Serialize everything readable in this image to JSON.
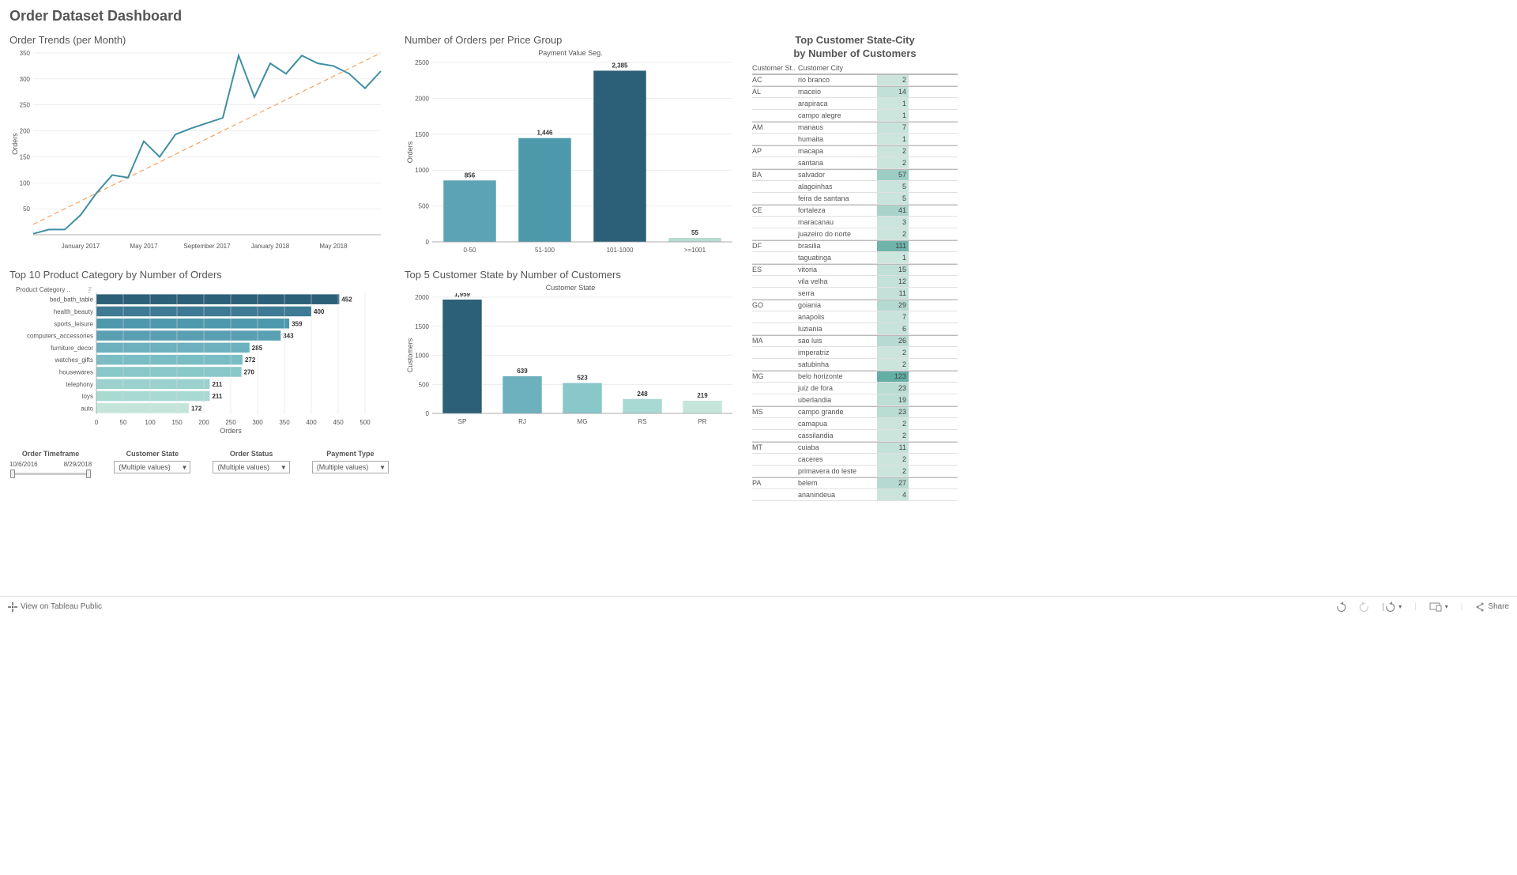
{
  "title": "Order Dataset Dashboard",
  "footer": {
    "tableau": "View on Tableau Public",
    "share": "Share"
  },
  "filters": {
    "timeframe_label": "Order Timeframe",
    "timeframe_start": "10/6/2016",
    "timeframe_end": "8/29/2018",
    "customer_state_label": "Customer State",
    "order_status_label": "Order Status",
    "payment_type_label": "Payment Type",
    "multiple_values": "(Multiple values)"
  },
  "chart_data": [
    {
      "id": "order_trends",
      "type": "line",
      "title": "Order Trends (per Month)",
      "ylabel": "Orders",
      "ylim": [
        0,
        350
      ],
      "yticks": [
        50,
        100,
        150,
        200,
        250,
        300,
        350
      ],
      "xticks": [
        "January 2017",
        "May 2017",
        "September 2017",
        "January 2018",
        "May 2018"
      ],
      "trendline": {
        "start_y": 20,
        "end_y": 350
      },
      "series": [
        {
          "name": "Orders",
          "x": [
            "Oct 2016",
            "Nov 2016",
            "Dec 2016",
            "Jan 2017",
            "Feb 2017",
            "Mar 2017",
            "Apr 2017",
            "May 2017",
            "Jun 2017",
            "Jul 2017",
            "Aug 2017",
            "Sep 2017",
            "Oct 2017",
            "Nov 2017",
            "Dec 2017",
            "Jan 2018",
            "Feb 2018",
            "Mar 2018",
            "Apr 2018",
            "May 2018",
            "Jun 2018",
            "Jul 2018",
            "Aug 2018"
          ],
          "values": [
            2,
            10,
            10,
            38,
            80,
            115,
            110,
            180,
            150,
            193,
            205,
            215,
            225,
            345,
            265,
            330,
            310,
            345,
            330,
            325,
            310,
            282,
            315
          ]
        }
      ]
    },
    {
      "id": "price_group",
      "type": "bar",
      "title": "Number of Orders per Price Group",
      "subtitle": "Payment Value Seg.",
      "ylabel": "Orders",
      "ylim": [
        0,
        2500
      ],
      "yticks": [
        0,
        500,
        1000,
        1500,
        2000,
        2500
      ],
      "categories": [
        "0-50",
        "51-100",
        "101-1000",
        ">=1001"
      ],
      "values": [
        856,
        1446,
        2385,
        55
      ],
      "colors": [
        "#5ca4b5",
        "#4e98ac",
        "#2c5f78",
        "#b8dbd2"
      ]
    },
    {
      "id": "top10_category",
      "type": "bar",
      "orientation": "horizontal",
      "title": "Top 10 Product Category by Number of Orders",
      "col_header": "Product Category ..",
      "xlabel": "Orders",
      "xlim": [
        0,
        500
      ],
      "xticks": [
        0,
        50,
        100,
        150,
        200,
        250,
        300,
        350,
        400,
        450,
        500
      ],
      "categories": [
        "bed_bath_table",
        "health_beauty",
        "sports_leisure",
        "computers_accessories",
        "furniture_decor",
        "watches_gifts",
        "housewares",
        "telephony",
        "toys",
        "auto"
      ],
      "values": [
        452,
        400,
        359,
        343,
        285,
        272,
        270,
        211,
        211,
        172
      ],
      "colors": [
        "#2c5f78",
        "#3e7a93",
        "#4e98ac",
        "#59a0b2",
        "#6cb1bd",
        "#7bbdc4",
        "#88c7ca",
        "#9bd1cf",
        "#a9d9d3",
        "#c5e5db"
      ]
    },
    {
      "id": "top5_state",
      "type": "bar",
      "title": "Top 5 Customer State by Number of Customers",
      "subtitle": "Customer State",
      "ylabel": "Customers",
      "ylim": [
        0,
        2000
      ],
      "yticks": [
        0,
        500,
        1000,
        1500,
        2000
      ],
      "categories": [
        "SP",
        "RJ",
        "MG",
        "RS",
        "PR"
      ],
      "values": [
        1959,
        639,
        523,
        248,
        219
      ],
      "colors": [
        "#2c5f78",
        "#6cb1bd",
        "#88c7ca",
        "#a9d9d3",
        "#c5e5db"
      ]
    },
    {
      "id": "state_city",
      "type": "table",
      "title": "Top Customer State-City by Number of Customers",
      "columns": [
        "Customer St..",
        "Customer City",
        ""
      ],
      "groups": [
        {
          "state": "AC",
          "rows": [
            [
              "rio branco",
              2
            ]
          ]
        },
        {
          "state": "AL",
          "rows": [
            [
              "maceio",
              14
            ],
            [
              "arapiraca",
              1
            ],
            [
              "campo alegre",
              1
            ]
          ]
        },
        {
          "state": "AM",
          "rows": [
            [
              "manaus",
              7
            ],
            [
              "humaita",
              1
            ]
          ]
        },
        {
          "state": "AP",
          "rows": [
            [
              "macapa",
              2
            ],
            [
              "santana",
              2
            ]
          ]
        },
        {
          "state": "BA",
          "rows": [
            [
              "salvador",
              57
            ],
            [
              "alagoinhas",
              5
            ],
            [
              "feira de santana",
              5
            ]
          ]
        },
        {
          "state": "CE",
          "rows": [
            [
              "fortaleza",
              41
            ],
            [
              "maracanau",
              3
            ],
            [
              "juazeiro do norte",
              2
            ]
          ]
        },
        {
          "state": "DF",
          "rows": [
            [
              "brasilia",
              111
            ],
            [
              "taguatinga",
              1
            ]
          ]
        },
        {
          "state": "ES",
          "rows": [
            [
              "vitoria",
              15
            ],
            [
              "vila velha",
              12
            ],
            [
              "serra",
              11
            ]
          ]
        },
        {
          "state": "GO",
          "rows": [
            [
              "goiania",
              29
            ],
            [
              "anapolis",
              7
            ],
            [
              "luziania",
              6
            ]
          ]
        },
        {
          "state": "MA",
          "rows": [
            [
              "sao luis",
              26
            ],
            [
              "imperatriz",
              2
            ],
            [
              "satubinha",
              2
            ]
          ]
        },
        {
          "state": "MG",
          "rows": [
            [
              "belo horizonte",
              123
            ],
            [
              "juiz de fora",
              23
            ],
            [
              "uberlandia",
              19
            ]
          ]
        },
        {
          "state": "MS",
          "rows": [
            [
              "campo grande",
              23
            ],
            [
              "camapua",
              2
            ],
            [
              "cassilandia",
              2
            ]
          ]
        },
        {
          "state": "MT",
          "rows": [
            [
              "cuiaba",
              11
            ],
            [
              "caceres",
              2
            ],
            [
              "primavera do leste",
              2
            ]
          ]
        },
        {
          "state": "PA",
          "rows": [
            [
              "belem",
              27
            ],
            [
              "ananindeua",
              4
            ]
          ]
        }
      ]
    }
  ]
}
